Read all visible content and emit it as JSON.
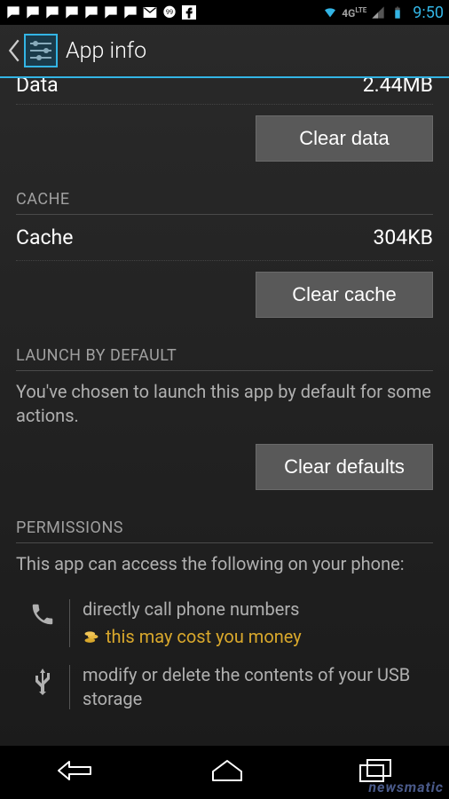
{
  "status": {
    "clock": "9:50",
    "network_label": "4G",
    "network_sup": "LTE"
  },
  "actionbar": {
    "title": "App info"
  },
  "data_section": {
    "row_label": "Data",
    "row_value": "2.44MB",
    "clear_button": "Clear data"
  },
  "cache_section": {
    "header": "CACHE",
    "row_label": "Cache",
    "row_value": "304KB",
    "clear_button": "Clear cache"
  },
  "launch_section": {
    "header": "LAUNCH BY DEFAULT",
    "description": "You've chosen to launch this app by default for some actions.",
    "clear_button": "Clear defaults"
  },
  "permissions_section": {
    "header": "PERMISSIONS",
    "description": "This app can access the following on your phone:",
    "items": [
      {
        "icon": "phone",
        "text": "directly call phone numbers",
        "warning": "this may cost you money"
      },
      {
        "icon": "usb",
        "text": "modify or delete the contents of your USB storage"
      }
    ]
  },
  "watermark": "newsmatic"
}
